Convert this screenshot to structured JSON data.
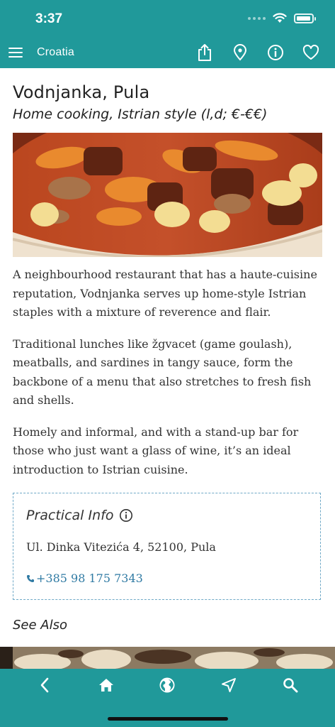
{
  "status_bar": {
    "time": "3:37"
  },
  "nav": {
    "title": "Croatia"
  },
  "article": {
    "title": "Vodnjanka, Pula",
    "subtitle": "Home cooking, Istrian style (l,d; €-€€)",
    "paragraphs": [
      "A neighbourhood restaurant that has a haute-cuisine reputation, Vodnjanka serves up home-style Istrian staples with a mixture of reverence and flair.",
      "Traditional lunches like žgvacet (game goulash), meatballs, and sardines in tangy sauce, form the backbone of a menu that also stretches to fresh fish and shells.",
      "Homely and informal, and with a stand-up bar for those who just want a glass of wine, it’s an ideal introduction to Istrian cuisine."
    ]
  },
  "practical_info": {
    "title": "Practical Info",
    "address": "Ul. Dinka Vitezića 4, 52100, Pula",
    "phone": "+385 98 175 7343"
  },
  "see_also": {
    "label": "See Also"
  },
  "colors": {
    "brand": "#20999a",
    "link": "#2f7aa3",
    "border": "#6fa9c7"
  },
  "icons": {
    "nav": [
      "menu-icon",
      "share-icon",
      "location-pin-icon",
      "info-icon",
      "heart-icon"
    ],
    "bottom": [
      "back-icon",
      "home-icon",
      "globe-icon",
      "navigate-icon",
      "search-icon"
    ]
  }
}
